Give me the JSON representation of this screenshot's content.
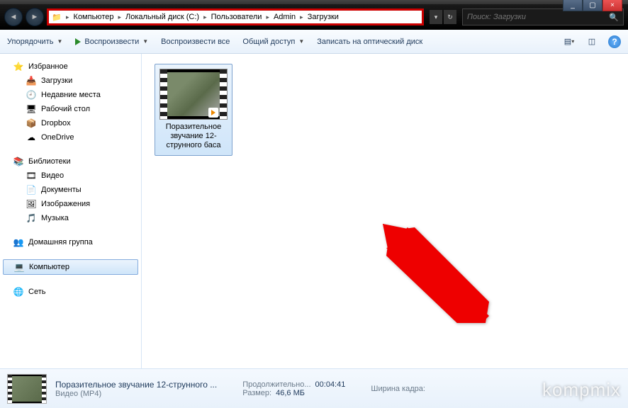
{
  "window_controls": {
    "min": "_",
    "max": "▢",
    "close": "×"
  },
  "breadcrumb": {
    "items": [
      "Компьютер",
      "Локальный диск (C:)",
      "Пользователи",
      "Admin",
      "Загрузки"
    ]
  },
  "search": {
    "placeholder": "Поиск: Загрузки"
  },
  "toolbar": {
    "organize": "Упорядочить",
    "play": "Воспроизвести",
    "play_all": "Воспроизвести все",
    "share": "Общий доступ",
    "burn": "Записать на оптический диск"
  },
  "sidebar": {
    "favorites": {
      "label": "Избранное",
      "items": [
        {
          "icon": "📥",
          "label": "Загрузки"
        },
        {
          "icon": "🕘",
          "label": "Недавние места"
        },
        {
          "icon": "🖥",
          "label": "Рабочий стол"
        },
        {
          "icon": "📦",
          "label": "Dropbox"
        },
        {
          "icon": "☁",
          "label": "OneDrive"
        }
      ]
    },
    "libraries": {
      "label": "Библиотеки",
      "items": [
        {
          "icon": "🎞",
          "label": "Видео"
        },
        {
          "icon": "📄",
          "label": "Документы"
        },
        {
          "icon": "🖼",
          "label": "Изображения"
        },
        {
          "icon": "🎵",
          "label": "Музыка"
        }
      ]
    },
    "homegroup": {
      "icon": "👥",
      "label": "Домашняя группа"
    },
    "computer": {
      "icon": "💻",
      "label": "Компьютер"
    },
    "network": {
      "icon": "🌐",
      "label": "Сеть"
    }
  },
  "files": [
    {
      "name": "Поразительное звучание 12-струнного баса"
    }
  ],
  "details": {
    "title": "Поразительное звучание 12-струнного ...",
    "type": "Видео (MP4)",
    "duration_label": "Продолжительно...",
    "duration": "00:04:41",
    "size_label": "Размер:",
    "size": "46,6 МБ",
    "width_label": "Ширина кадра:"
  },
  "watermark": "kompmix"
}
